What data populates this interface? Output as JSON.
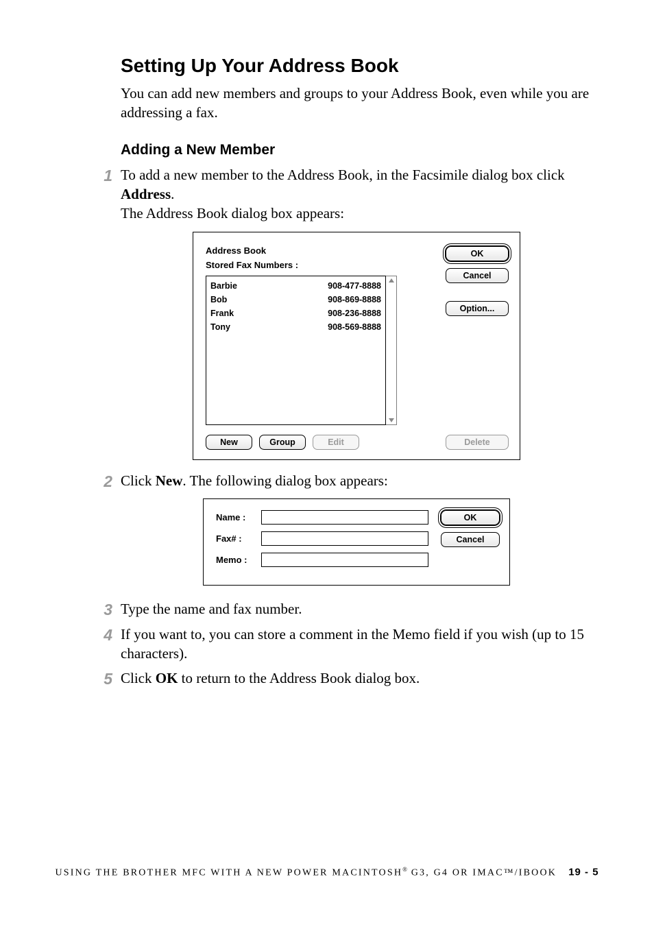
{
  "heading": "Setting Up Your Address Book",
  "intro": "You can add new members and groups to your Address Book, even while you are addressing a fax.",
  "subheading": "Adding a New Member",
  "steps": {
    "s1a": "To add a new member to the Address Book, in the Facsimile dialog box click ",
    "s1b": "Address",
    "s1c": ".",
    "s1d": "The Address Book dialog box appears:",
    "s2a": "Click ",
    "s2b": "New",
    "s2c": ". The following dialog box appears:",
    "s3": "Type the name and fax number.",
    "s4": "If you want to, you can store a comment in the Memo field if you wish (up to 15 characters).",
    "s5a": "Click ",
    "s5b": "OK",
    "s5c": " to return to the Address Book dialog box."
  },
  "addressBook": {
    "title": "Address Book",
    "subtitle": "Stored Fax Numbers :",
    "rows": [
      {
        "name": "Barbie",
        "fax": "908-477-8888"
      },
      {
        "name": "Bob",
        "fax": "908-869-8888"
      },
      {
        "name": "Frank",
        "fax": "908-236-8888"
      },
      {
        "name": "Tony",
        "fax": "908-569-8888"
      }
    ],
    "buttons": {
      "ok": "OK",
      "cancel": "Cancel",
      "option": "Option...",
      "new": "New",
      "group": "Group",
      "edit": "Edit",
      "delete": "Delete"
    }
  },
  "newMember": {
    "labels": {
      "name": "Name :",
      "fax": "Fax# :",
      "memo": "Memo :"
    },
    "buttons": {
      "ok": "OK",
      "cancel": "Cancel"
    }
  },
  "footer": {
    "text": "USING THE BROTHER MFC WITH A NEW POWER MACINTOSH",
    "reg": "®",
    "text2": " G3, G4 OR IMAC™/IBOOK",
    "page": "19 - 5"
  }
}
